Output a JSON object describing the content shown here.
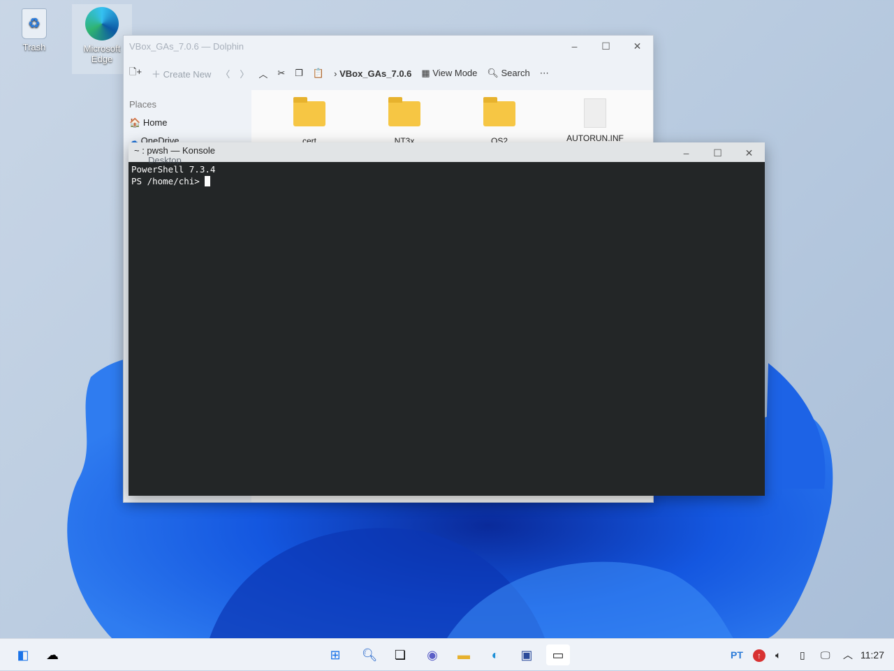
{
  "desktop": {
    "icons": [
      {
        "label": "Trash"
      },
      {
        "label": "Microsoft Edge"
      }
    ]
  },
  "dolphin": {
    "title": "VBox_GAs_7.0.6 — Dolphin",
    "toolbar": {
      "new_tab": "+",
      "create_new": "Create New",
      "breadcrumb": "VBox_GAs_7.0.6",
      "view_mode": "View Mode",
      "search": "Search"
    },
    "places": {
      "header": "Places",
      "items": [
        "Home",
        "OneDrive",
        "Desktop"
      ]
    },
    "files": [
      "cert",
      "NT3x",
      "OS2",
      "AUTORUN.INF"
    ]
  },
  "konsole": {
    "title": "~ : pwsh — Konsole",
    "lines": [
      "PowerShell 7.3.4",
      "PS /home/chi> "
    ]
  },
  "taskbar": {
    "lang": "PT",
    "clock": "11:27"
  }
}
